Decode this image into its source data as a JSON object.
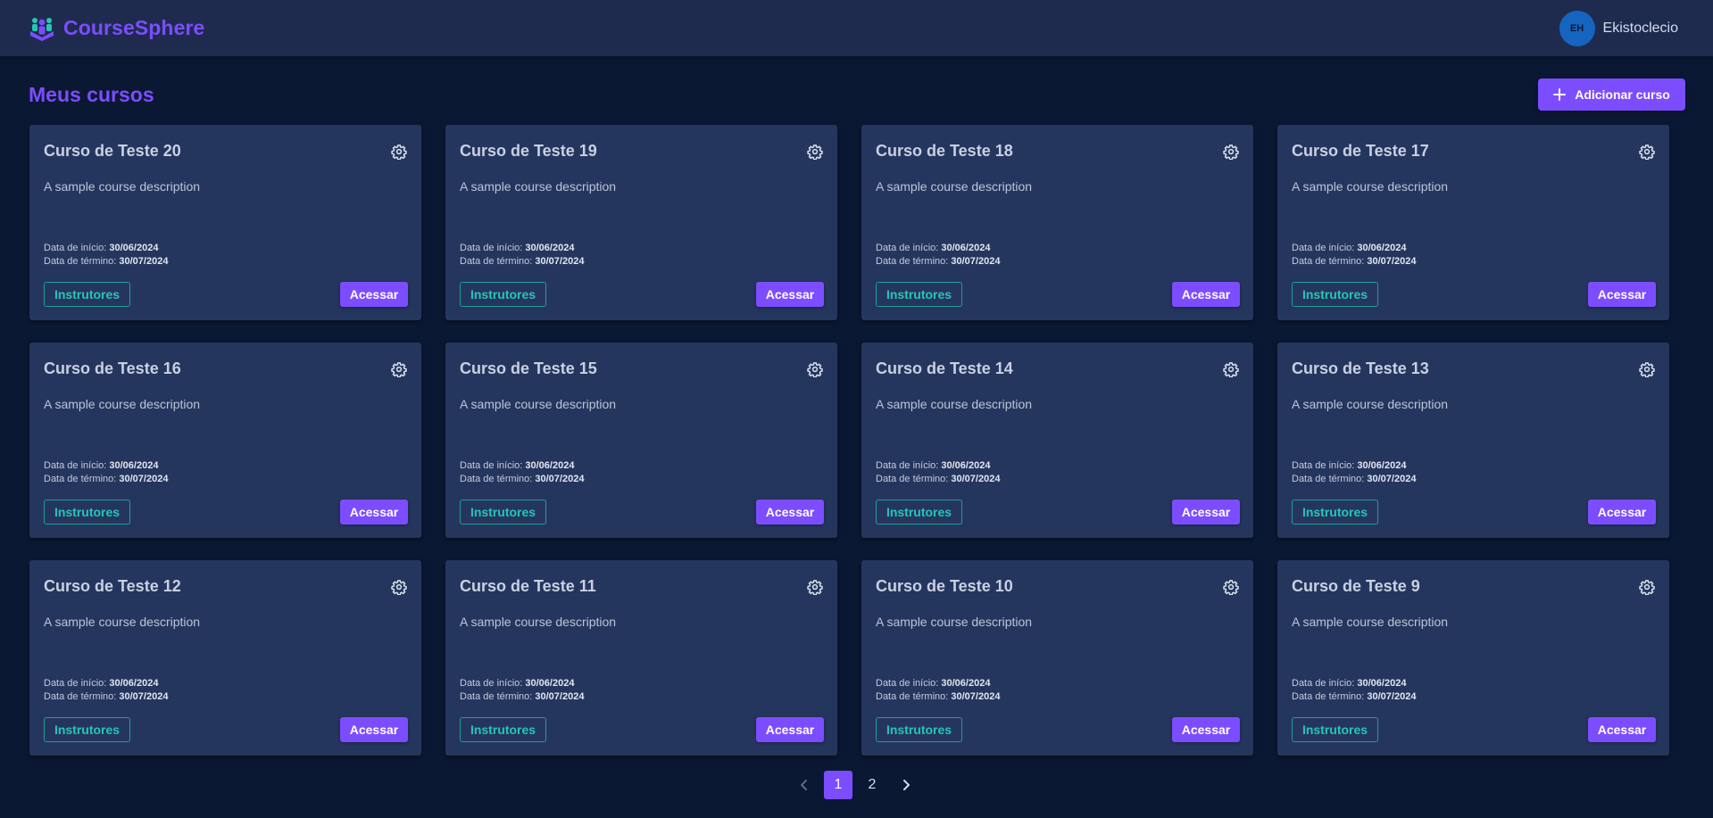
{
  "app": {
    "name": "CourseSphere"
  },
  "user": {
    "initials": "EH",
    "name": "Ekistoclecio"
  },
  "page": {
    "title": "Meus cursos",
    "add_button_label": "Adicionar curso"
  },
  "labels": {
    "start_prefix": "Data de início:",
    "end_prefix": "Data de término:",
    "instructors": "Instrutores",
    "access": "Acessar"
  },
  "courses": [
    {
      "title": "Curso de Teste 20",
      "description": "A sample course description",
      "start": "30/06/2024",
      "end": "30/07/2024"
    },
    {
      "title": "Curso de Teste 19",
      "description": "A sample course description",
      "start": "30/06/2024",
      "end": "30/07/2024"
    },
    {
      "title": "Curso de Teste 18",
      "description": "A sample course description",
      "start": "30/06/2024",
      "end": "30/07/2024"
    },
    {
      "title": "Curso de Teste 17",
      "description": "A sample course description",
      "start": "30/06/2024",
      "end": "30/07/2024"
    },
    {
      "title": "Curso de Teste 16",
      "description": "A sample course description",
      "start": "30/06/2024",
      "end": "30/07/2024"
    },
    {
      "title": "Curso de Teste 15",
      "description": "A sample course description",
      "start": "30/06/2024",
      "end": "30/07/2024"
    },
    {
      "title": "Curso de Teste 14",
      "description": "A sample course description",
      "start": "30/06/2024",
      "end": "30/07/2024"
    },
    {
      "title": "Curso de Teste 13",
      "description": "A sample course description",
      "start": "30/06/2024",
      "end": "30/07/2024"
    },
    {
      "title": "Curso de Teste 12",
      "description": "A sample course description",
      "start": "30/06/2024",
      "end": "30/07/2024"
    },
    {
      "title": "Curso de Teste 11",
      "description": "A sample course description",
      "start": "30/06/2024",
      "end": "30/07/2024"
    },
    {
      "title": "Curso de Teste 10",
      "description": "A sample course description",
      "start": "30/06/2024",
      "end": "30/07/2024"
    },
    {
      "title": "Curso de Teste 9",
      "description": "A sample course description",
      "start": "30/06/2024",
      "end": "30/07/2024"
    }
  ],
  "pagination": {
    "pages": [
      "1",
      "2"
    ],
    "current": "1"
  },
  "colors": {
    "accent": "#7c4dff",
    "teal": "#26c6b5",
    "background": "#0b1834",
    "card": "#25365e",
    "header": "#1e2b4f",
    "avatar": "#1565c0"
  },
  "icons": {
    "logo": "people-group-icon",
    "add": "plus-icon",
    "settings": "gear-icon",
    "prev": "chevron-left-icon",
    "next": "chevron-right-icon"
  }
}
